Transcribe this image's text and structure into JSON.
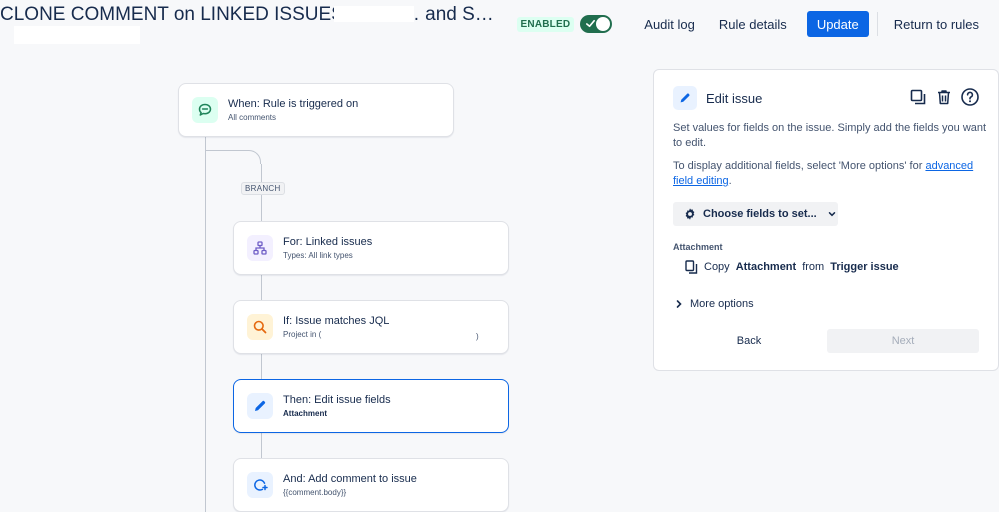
{
  "header": {
    "title": "CLONE COMMENT on LINKED ISSUES SUPP… and S…",
    "status_badge": "ENABLED",
    "toggle_on": true,
    "audit_log": "Audit log",
    "rule_details": "Rule details",
    "update": "Update",
    "return_to_rules": "Return to rules"
  },
  "flow": {
    "trigger": {
      "title": "When: Rule is triggered on",
      "subtitle": "All comments",
      "icon": "comment-icon",
      "color": "#1f845a"
    },
    "branch_tag": "BRANCH",
    "steps": [
      {
        "title": "For: Linked issues",
        "subtitle": "Types: All link types",
        "icon": "hierarchy-icon",
        "color": "#6e5dc6"
      },
      {
        "title": "If: Issue matches JQL",
        "subtitle": "Project in (",
        "icon": "search-icon",
        "color": "#e56910"
      },
      {
        "title": "Then: Edit issue fields",
        "subtitle": "Attachment",
        "icon": "pencil-icon",
        "color": "#0c66e4"
      },
      {
        "title": "And: Add comment to issue",
        "subtitle": "{{comment.body}}",
        "icon": "comment-add-icon",
        "color": "#0c66e4"
      }
    ]
  },
  "panel": {
    "title": "Edit issue",
    "description": "Set values for fields on the issue. Simply add the fields you want to edit.",
    "additional_text": "To display additional fields, select 'More options' for ",
    "advanced_link": "advanced field editing",
    "additional_suffix": ".",
    "choose_fields": "Choose fields to set...",
    "field_label": "Attachment",
    "attachment_copy": "Copy",
    "attachment_field": "Attachment",
    "attachment_from": "from",
    "attachment_source": "Trigger issue",
    "more_options": "More options",
    "back": "Back",
    "next": "Next"
  }
}
